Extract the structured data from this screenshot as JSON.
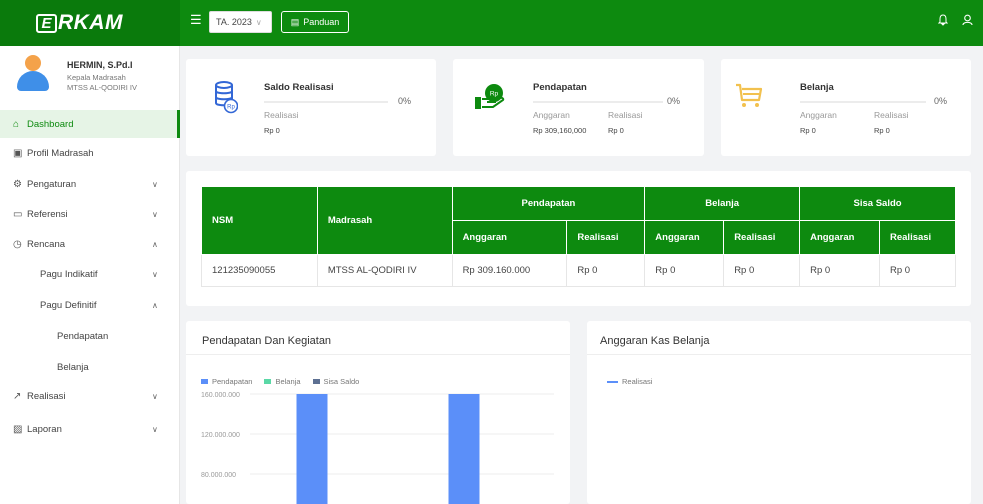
{
  "app": {
    "logo_letter": "E",
    "logo_text": "RKAM"
  },
  "header": {
    "menu_icon": "menu-toggle-icon",
    "year_select": "TA. 2023",
    "guide_button": "Panduan",
    "icons": [
      "bell-icon",
      "user-icon"
    ]
  },
  "profile": {
    "name": "HERMIN, S.Pd.I",
    "role": "Kepala Madrasah",
    "school": "MTSS AL-QODIRI IV"
  },
  "sidebar": {
    "items": [
      {
        "label": "Dashboard",
        "icon": "home-icon"
      },
      {
        "label": "Profil Madrasah",
        "icon": "id-card-icon"
      },
      {
        "label": "Pengaturan",
        "icon": "gear-icon"
      },
      {
        "label": "Referensi",
        "icon": "folder-icon"
      },
      {
        "label": "Rencana",
        "icon": "clock-icon"
      },
      {
        "label": "Pagu Indikatif"
      },
      {
        "label": "Pagu Definitif"
      },
      {
        "label": "Pendapatan"
      },
      {
        "label": "Belanja"
      },
      {
        "label": "Realisasi",
        "icon": "trend-icon"
      },
      {
        "label": "Laporan",
        "icon": "report-icon"
      }
    ]
  },
  "stats": {
    "saldo": {
      "title": "Saldo Realisasi",
      "percent": "0%",
      "label": "Realisasi",
      "value": "Rp 0",
      "progress": 0
    },
    "pendapatan": {
      "title": "Pendapatan",
      "percent": "0%",
      "label1": "Anggaran",
      "value1": "Rp 309,160,000",
      "label2": "Realisasi",
      "value2": "Rp 0",
      "progress": 0
    },
    "belanja": {
      "title": "Belanja",
      "percent": "0%",
      "label1": "Anggaran",
      "value1": "Rp 0",
      "label2": "Realisasi",
      "value2": "Rp 0",
      "progress": 0
    }
  },
  "table": {
    "headers": {
      "nsm": "NSM",
      "madrasah": "Madrasah",
      "pendapatan": "Pendapatan",
      "belanja": "Belanja",
      "sisa": "Sisa Saldo",
      "anggaran": "Anggaran",
      "realisasi": "Realisasi"
    },
    "rows": [
      [
        "121235090055",
        "MTSS AL-QODIRI IV",
        "Rp 309.160.000",
        "Rp 0",
        "Rp 0",
        "Rp 0",
        "Rp 0",
        "Rp 0"
      ]
    ]
  },
  "colors": {
    "brand": "#0d8a0f",
    "pendapatan": "#5b8ff9",
    "belanja": "#5ad8a6",
    "sisa": "#5d7092",
    "realisasi": "#5b8ff9"
  },
  "chart_data": [
    {
      "type": "bar",
      "title": "Pendapatan Dan Kegiatan",
      "categories": [
        "",
        ""
      ],
      "series": [
        {
          "name": "Pendapatan",
          "values": [
            160000000,
            160000000
          ]
        },
        {
          "name": "Belanja",
          "values": [
            0,
            0
          ]
        },
        {
          "name": "Sisa Saldo",
          "values": [
            0,
            0
          ]
        }
      ],
      "yticks": [
        "160.000.000",
        "120.000.000",
        "80.000.000"
      ],
      "ylim": [
        80000000,
        160000000
      ],
      "legend": "top-left",
      "grid": true
    },
    {
      "type": "line",
      "title": "Anggaran Kas Belanja",
      "series": [
        {
          "name": "Realisasi",
          "values": []
        }
      ],
      "legend": "top-left"
    }
  ]
}
